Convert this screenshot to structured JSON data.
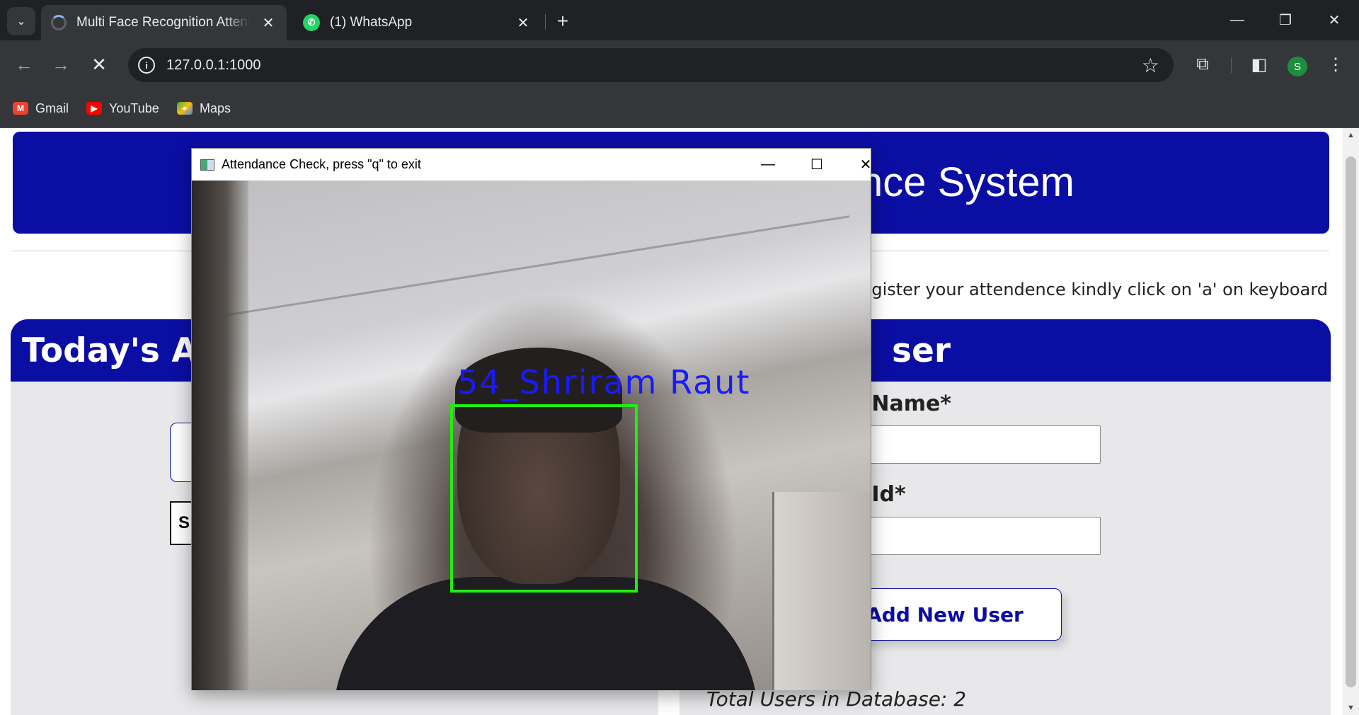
{
  "browser": {
    "tabs": [
      {
        "title": "Multi Face Recognition Attendance System",
        "active": true
      },
      {
        "title": "(1) WhatsApp",
        "active": false
      }
    ],
    "url": "127.0.0.1:1000",
    "bookmarks": [
      "Gmail",
      "YouTube",
      "Maps"
    ],
    "profile_initial": "S"
  },
  "page": {
    "header_title": "Face Recognition Based Attendance System",
    "visible_header_fragment": "nce System",
    "note": "on: to register your attendence kindly click on 'a' on keyboard",
    "left_panel_title": "Today's Att",
    "search_fragment": "S",
    "right_panel_title": "ser",
    "name_label": "ter New User Name*",
    "id_label": "ter New User Id*",
    "add_button": "Add New User",
    "total_users": "Total Users in Database: 2"
  },
  "cv_window": {
    "title": "Attendance Check, press \"q\" to exit",
    "face_label": "54_Shriram Raut"
  },
  "colors": {
    "brand_blue": "#0b0ea3",
    "face_box": "#22ee11",
    "face_label": "#1a1aff"
  }
}
